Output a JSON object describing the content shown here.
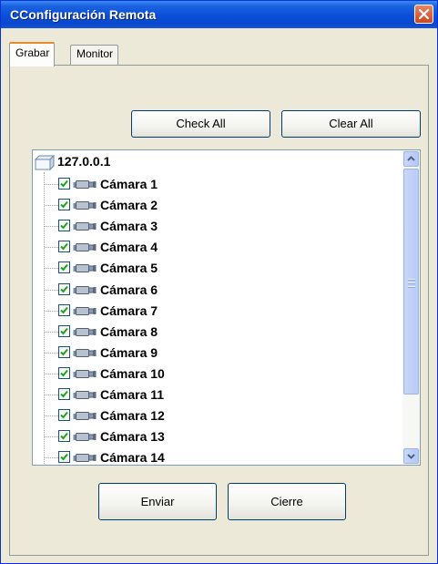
{
  "window": {
    "title": "CConfiguración Remota"
  },
  "tabs": [
    {
      "label": "Grabar",
      "active": true
    },
    {
      "label": "Monitor",
      "active": false
    }
  ],
  "buttons": {
    "check_all": "Check All",
    "clear_all": "Clear All",
    "send": "Enviar",
    "close": "Cierre"
  },
  "tree": {
    "root": "127.0.0.1",
    "items": [
      {
        "label": "Cámara 1",
        "checked": true
      },
      {
        "label": "Cámara 2",
        "checked": true
      },
      {
        "label": "Cámara 3",
        "checked": true
      },
      {
        "label": "Cámara 4",
        "checked": true
      },
      {
        "label": "Cámara 5",
        "checked": true
      },
      {
        "label": "Cámara 6",
        "checked": true
      },
      {
        "label": "Cámara 7",
        "checked": true
      },
      {
        "label": "Cámara 8",
        "checked": true
      },
      {
        "label": "Cámara 9",
        "checked": true
      },
      {
        "label": "Cámara 10",
        "checked": true
      },
      {
        "label": "Cámara 11",
        "checked": true
      },
      {
        "label": "Cámara 12",
        "checked": true
      },
      {
        "label": "Cámara 13",
        "checked": true
      },
      {
        "label": "Cámara 14",
        "checked": true
      }
    ]
  },
  "colors": {
    "titlebar": "#0A4ED8",
    "face": "#ECE9D8",
    "check": "#21A121",
    "tab_highlight": "#E68B2C"
  },
  "icons": {
    "close": "close-icon",
    "root": "computer-icon",
    "camera": "camera-icon",
    "checkbox": "checkmark-icon"
  }
}
